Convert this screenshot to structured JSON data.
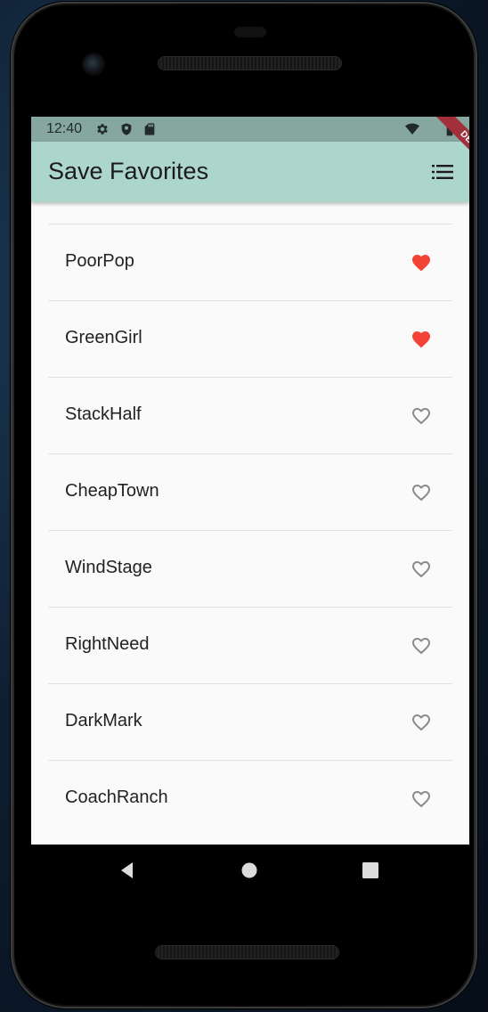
{
  "status_bar": {
    "time": "12:40",
    "left_icons": [
      "settings-icon",
      "shield-icon",
      "sd-card-icon"
    ],
    "right_icons": [
      "wifi-icon",
      "battery-icon"
    ]
  },
  "app_bar": {
    "title": "Save Favorites",
    "action_icon": "list-icon",
    "background": "#acd5cc"
  },
  "debug_banner": {
    "label": "DEBUG",
    "color": "#a2303a"
  },
  "favorites": {
    "filled_color": "#f44336",
    "outline_color": "#8a8a8a",
    "items": [
      {
        "label": "PoorPop",
        "favorite": true
      },
      {
        "label": "GreenGirl",
        "favorite": true
      },
      {
        "label": "StackHalf",
        "favorite": false
      },
      {
        "label": "CheapTown",
        "favorite": false
      },
      {
        "label": "WindStage",
        "favorite": false
      },
      {
        "label": "RightNeed",
        "favorite": false
      },
      {
        "label": "DarkMark",
        "favorite": false
      },
      {
        "label": "CoachRanch",
        "favorite": false
      }
    ]
  },
  "nav_bar": {
    "buttons": [
      "back-icon",
      "home-icon",
      "recents-icon"
    ]
  }
}
